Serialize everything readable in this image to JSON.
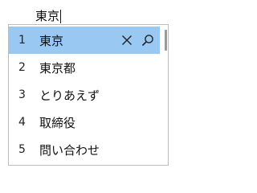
{
  "composition": {
    "text": "東京"
  },
  "candidates": [
    {
      "number": "1",
      "text": "東京"
    },
    {
      "number": "2",
      "text": "東京都"
    },
    {
      "number": "3",
      "text": "とりあえず"
    },
    {
      "number": "4",
      "text": "取締役"
    },
    {
      "number": "5",
      "text": "問い合わせ"
    }
  ],
  "selected_index": 0,
  "icons": {
    "remove": "close-icon",
    "search": "search-icon"
  },
  "colors": {
    "selection": "#99c8f3",
    "border": "#bdbdbd",
    "text": "#111111"
  }
}
